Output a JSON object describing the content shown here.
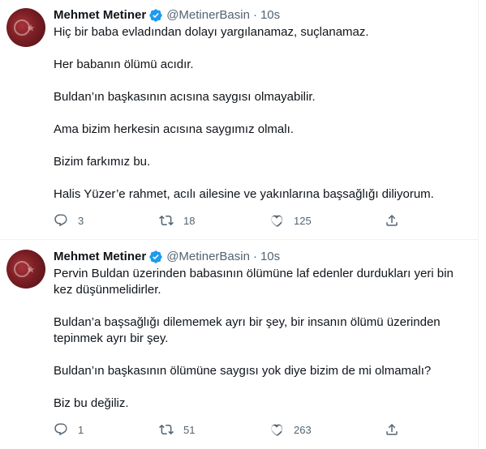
{
  "tweets": [
    {
      "author": {
        "name": "Mehmet Metiner",
        "handle": "@MetinerBasin",
        "time": "10s",
        "separator": "·",
        "avatar_icon": "avatar-image",
        "verified_icon": "verified-badge-icon"
      },
      "paragraphs": [
        "Hiç bir baba evladından dolayı yargılanamaz, suçlanamaz.",
        "Her babanın ölümü acıdır.",
        "Buldan’ın başkasının acısına saygısı olmayabilir.",
        "Ama bizim herkesin acısına saygımız olmalı.",
        "Bizim farkımız bu.",
        "Halis Yüzer’e rahmet, acılı ailesine ve yakınlarına başsağlığı diliyorum."
      ],
      "stats": {
        "replies": "3",
        "retweets": "18",
        "likes": "125"
      }
    },
    {
      "author": {
        "name": "Mehmet Metiner",
        "handle": "@MetinerBasin",
        "time": "10s",
        "separator": "·",
        "avatar_icon": "avatar-image",
        "verified_icon": "verified-badge-icon"
      },
      "paragraphs": [
        "Pervin Buldan üzerinden babasının ölümüne laf edenler durdukları yeri bin kez düşünmelidirler.",
        "Buldan’a başsağlığı dilememek ayrı bir şey, bir insanın ölümü üzerinden tepinmek ayrı bir şey.",
        "Buldan’ın başkasının ölümüne saygısı yok diye bizim de mi olmamalı?",
        "Biz bu değiliz."
      ],
      "stats": {
        "replies": "1",
        "retweets": "51",
        "likes": "263"
      }
    }
  ],
  "colors": {
    "text": "#0f1419",
    "secondary": "#536471",
    "verified": "#1d9bf0",
    "divider": "#eff3f4"
  },
  "icons": {
    "reply": "reply-icon",
    "retweet": "retweet-icon",
    "like": "like-icon",
    "share": "share-icon"
  }
}
